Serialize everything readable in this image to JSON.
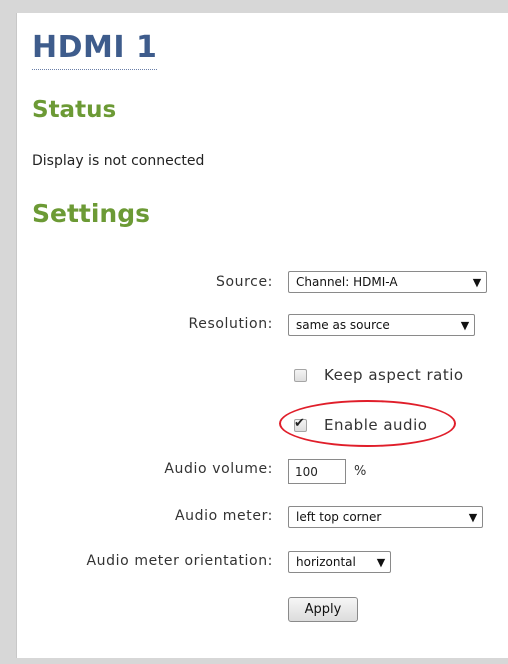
{
  "page": {
    "title": "HDMI 1",
    "status_heading": "Status",
    "status_text": "Display is not connected",
    "settings_heading": "Settings"
  },
  "settings": {
    "source": {
      "label": "Source:",
      "value": "Channel: HDMI-A",
      "icon": "dropdown-arrow"
    },
    "resolution": {
      "label": "Resolution:",
      "value": "same as source",
      "icon": "dropdown-arrow"
    },
    "keep_aspect_ratio": {
      "label": "Keep aspect ratio",
      "checked": false
    },
    "enable_audio": {
      "label": "Enable audio",
      "checked": true,
      "highlighted": true
    },
    "audio_volume": {
      "label": "Audio volume:",
      "value": "100",
      "unit": "%"
    },
    "audio_meter": {
      "label": "Audio meter:",
      "value": "left top corner",
      "icon": "dropdown-arrow"
    },
    "audio_meter_orientation": {
      "label": "Audio meter orientation:",
      "value": "horizontal",
      "icon": "dropdown-arrow"
    },
    "apply_label": "Apply"
  },
  "colors": {
    "title": "#3e5c8c",
    "headings": "#6c9a35",
    "highlight_ring": "#e01e2a",
    "frame": "#d7d7d7"
  },
  "glyphs": {
    "arrow": "▼",
    "check": "✔"
  }
}
